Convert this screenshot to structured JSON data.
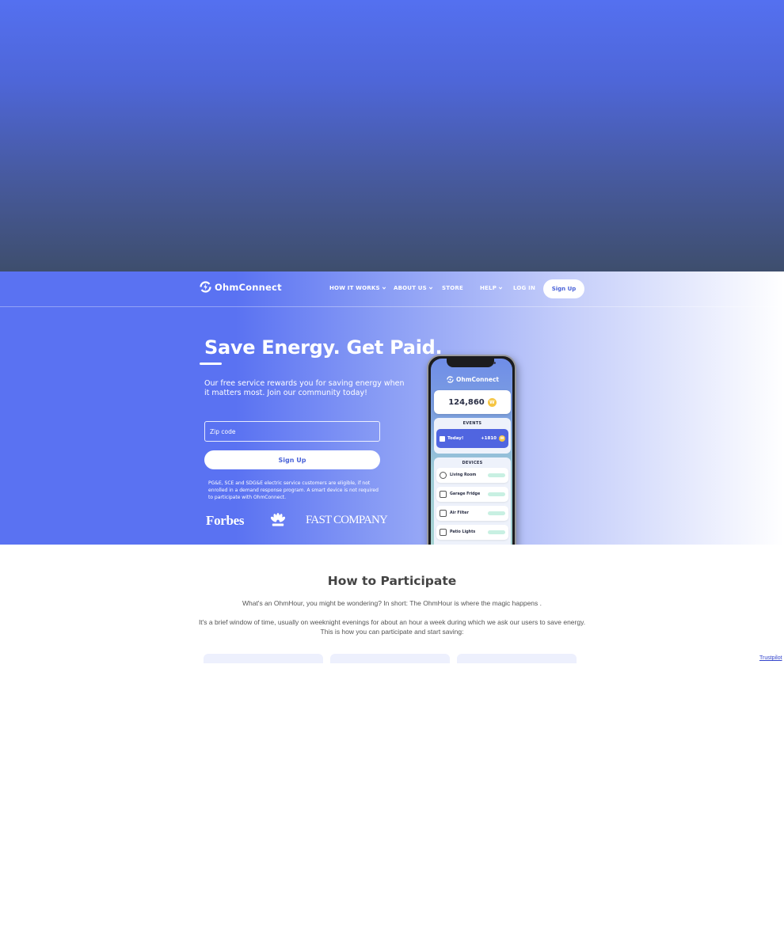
{
  "brand": {
    "name": "OhmConnect"
  },
  "nav": {
    "items": [
      {
        "label": "HOW IT WORKS",
        "has_dropdown": true
      },
      {
        "label": "ABOUT US",
        "has_dropdown": true
      },
      {
        "label": "STORE",
        "has_dropdown": false
      },
      {
        "label": "HELP",
        "has_dropdown": true
      },
      {
        "label": "LOG IN",
        "has_dropdown": false
      }
    ],
    "signup_label": "Sign Up"
  },
  "hero": {
    "headline": "Save Energy. Get Paid.",
    "subline": "Our free service rewards you for saving energy when it matters most. Join our community today!",
    "zip_placeholder": "Zip code",
    "signup_button": "Sign Up",
    "disclaimer": "PG&E, SCE and SDG&E electric service customers are eligible, if not enrolled in a demand response program. A smart device is not required to participate with OhmConnect.",
    "press": {
      "forbes": "Forbes",
      "nbc": "CNBC",
      "fastcompany": "FAST COMPANY"
    }
  },
  "phone": {
    "app_name": "OhmConnect",
    "points": "124,860",
    "coin_symbol": "W",
    "events_title": "EVENTS",
    "event": {
      "label": "Today!",
      "points": "+1810"
    },
    "devices_title": "DEVICES",
    "devices": [
      "Living Room",
      "Garage Fridge",
      "Air Filter",
      "Patio Lights"
    ]
  },
  "section": {
    "title": "How to Participate",
    "paragraph_1": "What's an OhmHour, you might be wondering? In short: The OhmHour is where the magic happens .",
    "paragraph_2": "It's a brief window of time, usually on weeknight evenings for about an hour a week during which we ask our users to save energy. This is how you can participate and start saving:"
  },
  "trustpilot": {
    "label": "Trustpilot"
  },
  "colors": {
    "brand_blue": "#5a72f2",
    "button_text": "#4a63d8",
    "coin": "#f5c542"
  }
}
